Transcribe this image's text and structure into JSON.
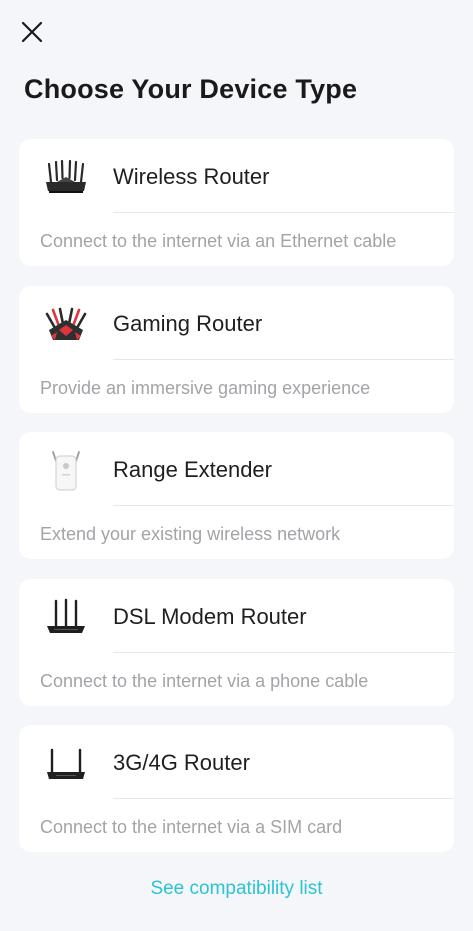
{
  "header": {
    "close_icon": "close-icon",
    "title": "Choose Your Device Type"
  },
  "devices": [
    {
      "name": "Wireless Router",
      "description": "Connect to the internet via an Ethernet cable",
      "icon": "wireless-router-icon"
    },
    {
      "name": "Gaming Router",
      "description": "Provide an immersive gaming experience",
      "icon": "gaming-router-icon",
      "accent": "#e0353f"
    },
    {
      "name": "Range Extender",
      "description": "Extend your existing wireless network",
      "icon": "range-extender-icon"
    },
    {
      "name": "DSL Modem Router",
      "description": "Connect to the internet via a phone cable",
      "icon": "dsl-modem-router-icon"
    },
    {
      "name": "3G/4G Router",
      "description": "Connect to the internet via a SIM card",
      "icon": "lte-router-icon"
    }
  ],
  "footer": {
    "compatibility_link": "See compatibility list",
    "link_color": "#2cc3d3"
  },
  "colors": {
    "background": "#f5f6fa",
    "card": "#ffffff",
    "description_text": "#a3a3a8"
  }
}
